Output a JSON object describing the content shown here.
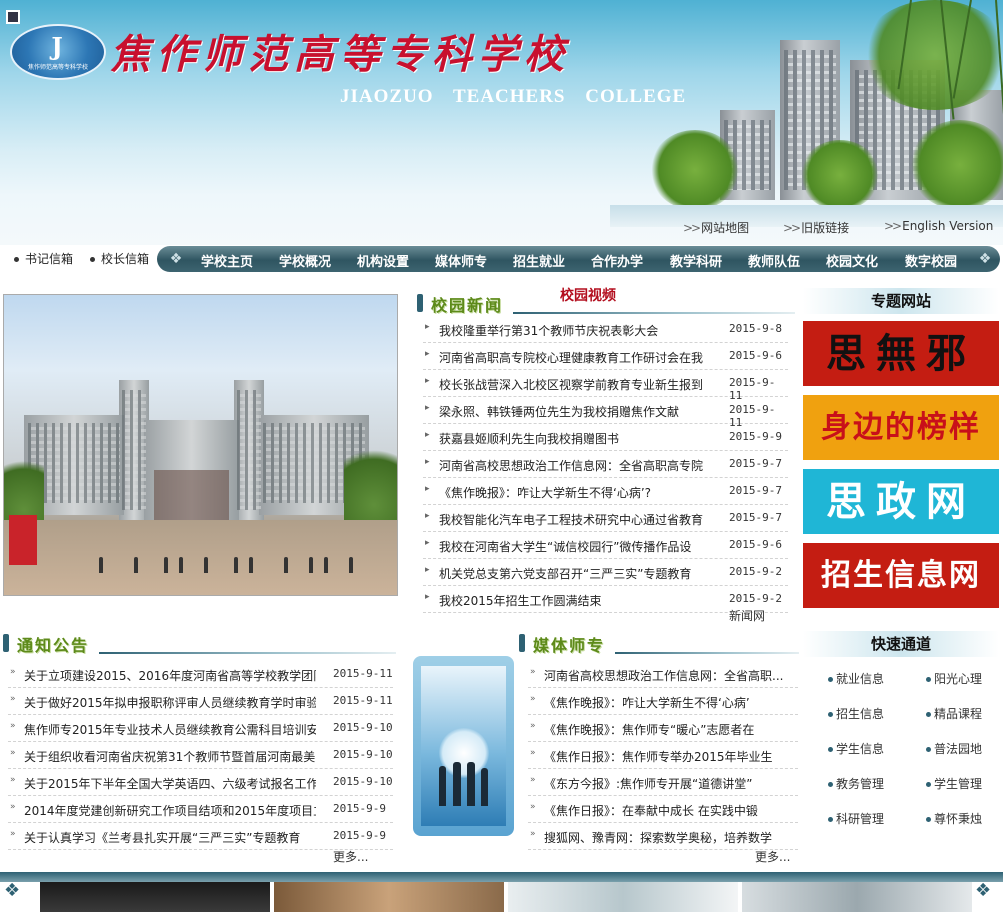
{
  "header": {
    "school_name_cn": "焦作师范高等专科学校",
    "school_name_en": "JIAOZUO TEACHERS COLLEGE",
    "logo_caption": "焦作师范高等专科学校",
    "top_links": [
      "网站地图",
      "旧版链接",
      "English Version"
    ]
  },
  "nav": {
    "left_links": [
      "书记信箱",
      "校长信箱"
    ],
    "items": [
      "学校主页",
      "学校概况",
      "机构设置",
      "媒体师专",
      "招生就业",
      "合作办学",
      "教学科研",
      "教师队伍",
      "校园文化",
      "数字校园"
    ]
  },
  "campus_news": {
    "title": "校园新闻",
    "video_tab": "校园视频",
    "more": "新闻网",
    "items": [
      {
        "title": "我校隆重举行第31个教师节庆祝表彰大会",
        "date": "2015-9-8"
      },
      {
        "title": "河南省高职高专院校心理健康教育工作研讨会在我",
        "date": "2015-9-6"
      },
      {
        "title": "校长张战营深入北校区视察学前教育专业新生报到",
        "date": "2015-9-11"
      },
      {
        "title": "梁永照、韩铁锤两位先生为我校捐赠焦作文献",
        "date": "2015-9-11"
      },
      {
        "title": "获嘉县姬顺利先生向我校捐赠图书",
        "date": "2015-9-9"
      },
      {
        "title": "河南省高校思想政治工作信息网：全省高职高专院",
        "date": "2015-9-7"
      },
      {
        "title": "《焦作晚报》：咋让大学新生不得‘心病’?",
        "date": "2015-9-7"
      },
      {
        "title": "我校智能化汽车电子工程技术研究中心通过省教育",
        "date": "2015-9-7"
      },
      {
        "title": "我校在河南省大学生“诚信校园行”微传播作品设",
        "date": "2015-9-6"
      },
      {
        "title": "机关党总支第六党支部召开“三严三实”专题教育",
        "date": "2015-9-2"
      },
      {
        "title": "我校2015年招生工作圆满结束",
        "date": "2015-9-2"
      }
    ]
  },
  "notices": {
    "title": "通知公告",
    "more": "更多...",
    "items": [
      {
        "title": "关于立项建设2015、2016年度河南省高等学校教学团队",
        "date": "2015-9-11"
      },
      {
        "title": "关于做好2015年拟申报职称评审人员继续教育学时审验",
        "date": "2015-9-11"
      },
      {
        "title": "焦作师专2015年专业技术人员继续教育公需科目培训安",
        "date": "2015-9-10"
      },
      {
        "title": "关于组织收看河南省庆祝第31个教师节暨首届河南最美",
        "date": "2015-9-10"
      },
      {
        "title": "关于2015年下半年全国大学英语四、六级考试报名工作",
        "date": "2015-9-10"
      },
      {
        "title": "2014年度党建创新研究工作项目结项和2015年度项目立",
        "date": "2015-9-9"
      },
      {
        "title": "关于认真学习《兰考县扎实开展“三严三实”专题教育",
        "date": "2015-9-9"
      }
    ]
  },
  "media": {
    "title": "媒体师专",
    "more": "更多...",
    "items": [
      "河南省高校思想政治工作信息网：全省高职...",
      "《焦作晚报》：咋让大学新生不得‘心病’",
      "《焦作晚报》：焦作师专“暖心”志愿者在",
      "《焦作日报》：焦作师专举办2015年毕业生",
      "《东方今报》:焦作师专开展“道德讲堂”",
      "《焦作日报》：在奉献中成长 在实践中锻",
      "搜狐网、豫青网：探索数学奥秘，培养数学"
    ]
  },
  "special_sites": {
    "title": "专题网站",
    "banners": [
      {
        "label": "思無邪",
        "bg": "#c41d12",
        "fg": "#111111"
      },
      {
        "label": "身边的榜样",
        "bg": "#f0a10f",
        "fg": "#c8101a"
      },
      {
        "label": "思政网",
        "bg": "#1fb6d6",
        "fg": "#ffffff"
      },
      {
        "label": "招生信息网",
        "bg": "#c41d12",
        "fg": "#ffffff"
      }
    ]
  },
  "quick_links": {
    "title": "快速通道",
    "items": [
      "就业信息",
      "阳光心理",
      "招生信息",
      "精品课程",
      "学生信息",
      "普法园地",
      "教务管理",
      "学生管理",
      "科研管理",
      "尊怀秉烛"
    ]
  },
  "colors": {
    "accent_teal": "#2e6173",
    "title_red": "#c8102e",
    "section_green": "#5d8a1a"
  }
}
